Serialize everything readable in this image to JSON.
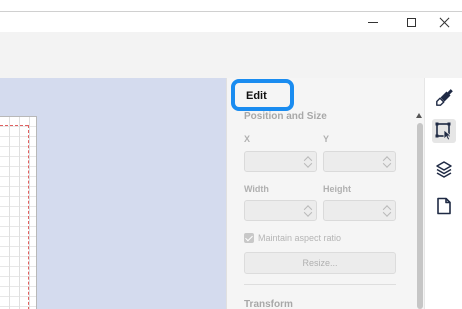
{
  "window": {
    "controls": [
      {
        "name": "minimize",
        "icon": "minimize-icon"
      },
      {
        "name": "maximize",
        "icon": "maximize-icon"
      },
      {
        "name": "close",
        "icon": "close-icon"
      }
    ]
  },
  "panel": {
    "title": "Edit",
    "position_size": {
      "heading": "Position and Size",
      "x_label": "X",
      "y_label": "Y",
      "x_value": "",
      "y_value": "",
      "width_label": "Width",
      "height_label": "Height",
      "width_value": "",
      "height_value": "",
      "aspect_label": "Maintain aspect ratio",
      "aspect_checked": true,
      "resize_label": "Resize..."
    },
    "transform": {
      "heading": "Transform"
    }
  },
  "rail": {
    "items": [
      {
        "name": "style",
        "icon": "paint-brush-icon"
      },
      {
        "name": "edit",
        "icon": "select-arrange-icon",
        "active": true
      },
      {
        "name": "layers",
        "icon": "layers-icon"
      },
      {
        "name": "page",
        "icon": "page-icon"
      }
    ]
  },
  "colors": {
    "highlight": "#1a8cf0",
    "canvas_background": "#d4dbee",
    "icon": "#1f2a44"
  }
}
